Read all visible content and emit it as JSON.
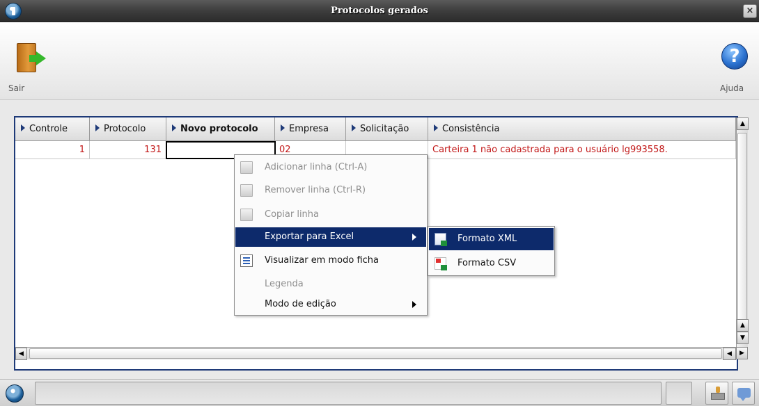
{
  "window": {
    "title": "Protocolos gerados",
    "close_label": "×"
  },
  "toolbar": {
    "exit_label": "Sair",
    "help_label": "Ajuda",
    "help_glyph": "?"
  },
  "grid": {
    "columns": [
      "Controle",
      "Protocolo",
      "Novo protocolo",
      "Empresa",
      "Solicitação",
      "Consistência"
    ],
    "row": {
      "controle": "1",
      "protocolo": "131",
      "novo_protocolo": "",
      "empresa": "02",
      "solicitacao": "",
      "consistencia": "Carteira 1 não cadastrada para o usuário lg993558."
    }
  },
  "context_menu": {
    "items": [
      {
        "label": "Adicionar linha (Ctrl-A)",
        "icon": "add-row-icon",
        "enabled": false
      },
      {
        "label": "Remover linha (Ctrl-R)",
        "icon": "remove-row-icon",
        "enabled": false
      },
      {
        "label": "Copiar linha",
        "icon": "copy-row-icon",
        "enabled": false
      },
      {
        "label": "Exportar para Excel",
        "icon": "",
        "enabled": true,
        "submenu": true
      },
      {
        "label": "Visualizar em modo ficha",
        "icon": "form-view-icon",
        "enabled": true
      },
      {
        "label": "Legenda",
        "icon": "",
        "enabled": false
      },
      {
        "label": "Modo de edição",
        "icon": "",
        "enabled": true,
        "submenu": true
      }
    ]
  },
  "submenu": {
    "items": [
      {
        "label": "Formato XML",
        "icon": "xml-excel-icon"
      },
      {
        "label": "Formato CSV",
        "icon": "csv-excel-icon"
      }
    ]
  },
  "colors": {
    "title_bar": "#3d3d3d",
    "selection": "#0d2a6b",
    "grid_border": "#1e3a78",
    "error_text": "#c21818"
  }
}
